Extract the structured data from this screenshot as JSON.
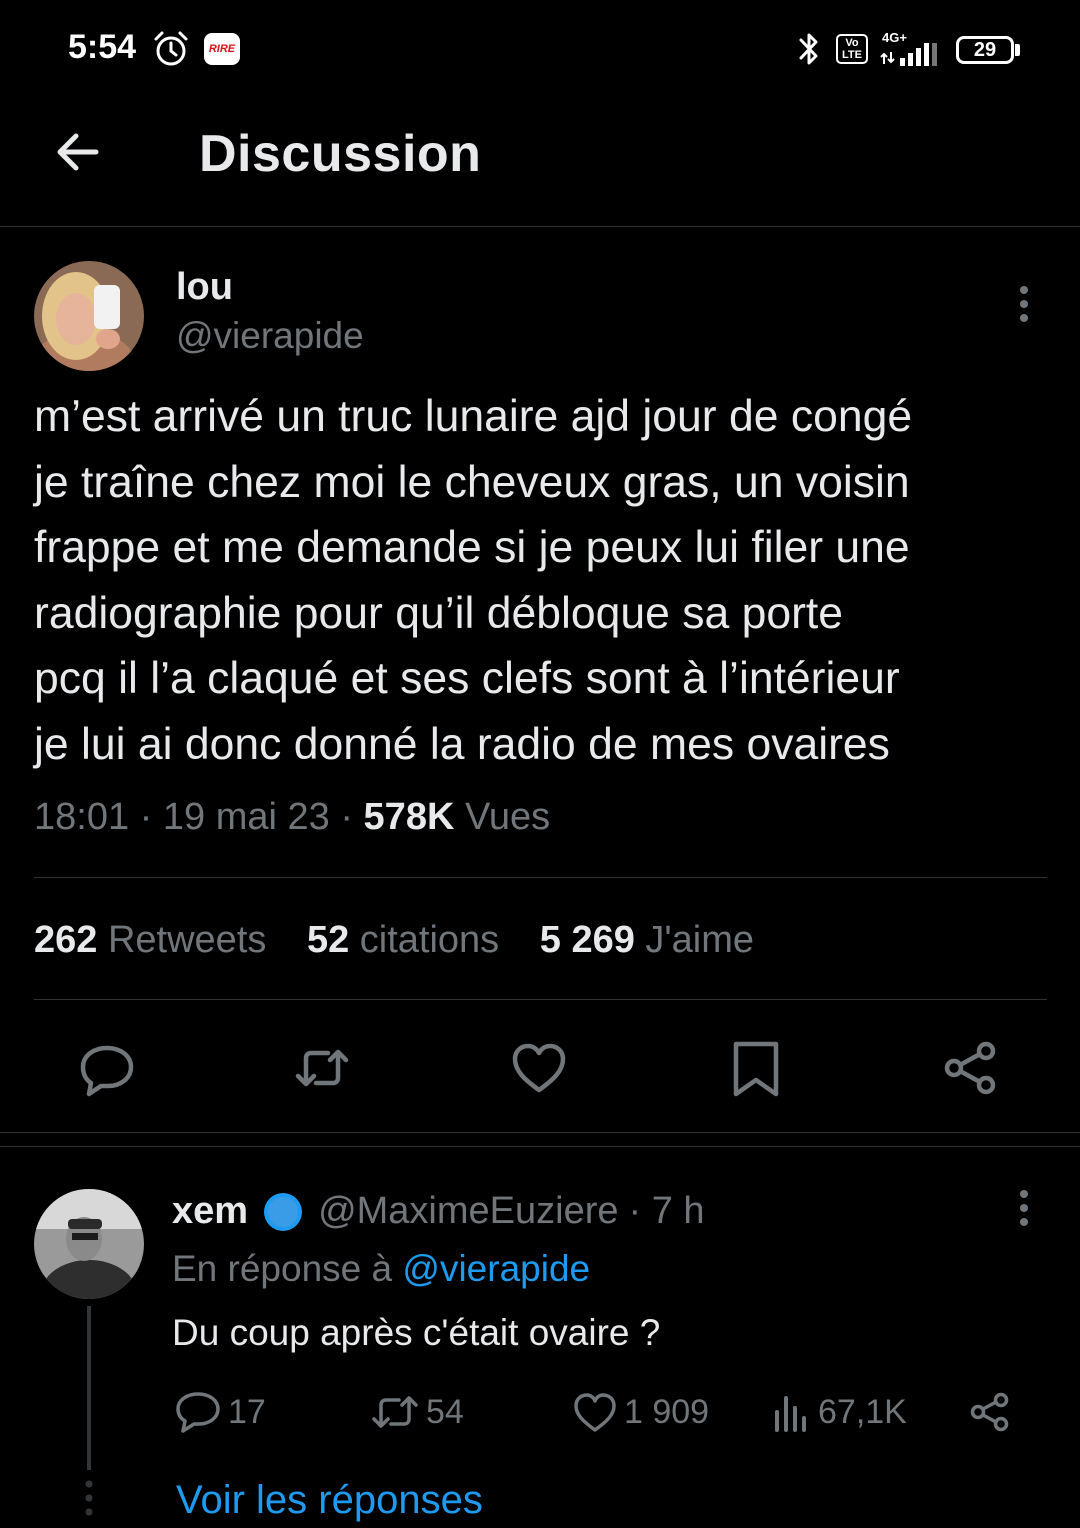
{
  "status_bar": {
    "time": "5:54",
    "app_badge": "RIRE",
    "volte": "Vo LTE",
    "network": "4G+",
    "battery": "29"
  },
  "header": {
    "title": "Discussion"
  },
  "tweet": {
    "author_name": "lou",
    "author_handle": "@vierapide",
    "text": "m’est arrivé un truc lunaire ajd jour de congé\nje traîne chez moi le cheveux gras, un voisin\nfrappe et me demande si je peux lui filer une\nradiographie pour qu’il débloque sa porte\npcq il l’a claqué et ses clefs sont à l’intérieur\nje lui ai donc donné la radio de mes ovaires",
    "time": "18:01",
    "date": "19 mai 23",
    "views_count": "578K",
    "views_label": "Vues",
    "separator": "·",
    "retweets_count": "262",
    "retweets_label": "Retweets",
    "quotes_count": "52",
    "quotes_label": "citations",
    "likes_count": "5 269",
    "likes_label": "J'aime"
  },
  "reply": {
    "author_name": "xem",
    "author_handle": "@MaximeEuziere",
    "time_ago": "· 7 h",
    "in_reply_prefix": "En réponse à",
    "in_reply_handle": "@vierapide",
    "text": "Du coup après c'était ovaire ?",
    "replies": "17",
    "retweets": "54",
    "likes": "1 909",
    "views": "67,1K",
    "see_replies": "Voir les réponses"
  },
  "colors": {
    "background": "#000000",
    "text": "#e7e9ea",
    "muted": "#71767b",
    "accent": "#1d9bf0",
    "divider": "#2f3336"
  },
  "icons": {
    "back": "arrow-left-icon",
    "more": "more-vertical-icon",
    "reply": "comment-icon",
    "retweet": "retweet-icon",
    "like": "heart-icon",
    "bookmark": "bookmark-icon",
    "share": "share-icon",
    "views": "views-chart-icon",
    "verified": "verified-badge-icon"
  }
}
